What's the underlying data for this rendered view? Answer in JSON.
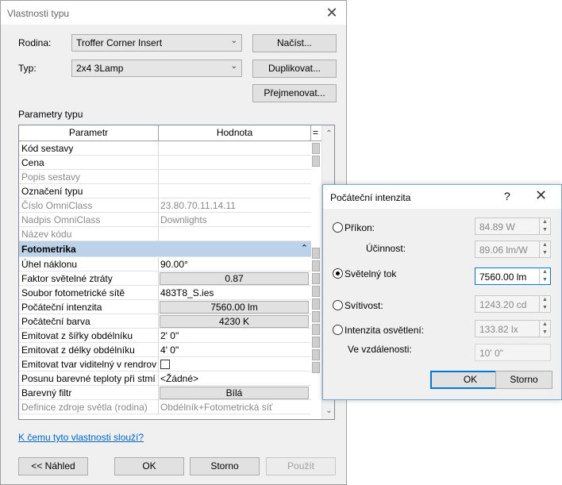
{
  "main": {
    "title": "Vlastnosti typu",
    "family_label": "Rodina:",
    "family_value": "Troffer Corner Insert",
    "type_label": "Typ:",
    "type_value": "2x4 3Lamp",
    "load_button": "Načíst...",
    "duplicate_button": "Duplikovat...",
    "rename_button": "Přejmenovat...",
    "params_label": "Parametry typu",
    "columns": [
      "Parametr",
      "Hodnota",
      "="
    ],
    "rows": [
      {
        "name": "Kód sestavy",
        "value": ""
      },
      {
        "name": "Cena",
        "value": ""
      },
      {
        "name": "Popis sestavy",
        "value": ""
      },
      {
        "name": "Označení typu",
        "value": ""
      },
      {
        "name": "Číslo OmniClass",
        "value": "23.80.70.11.14.11"
      },
      {
        "name": "Nadpis OmniClass",
        "value": "Downlights"
      },
      {
        "name": "Název kódu",
        "value": ""
      }
    ],
    "section": "Fotometrika",
    "photo_rows": [
      {
        "name": "Úhel náklonu",
        "value": "90.00°"
      },
      {
        "name": "Faktor světelné ztráty",
        "value": "0.87"
      },
      {
        "name": "Soubor fotometrické sítě",
        "value": "483T8_S.ies"
      },
      {
        "name": "Počáteční intenzita",
        "value": "7560.00 lm"
      },
      {
        "name": "Počáteční barva",
        "value": "4230 K"
      },
      {
        "name": "Emitovat z šířky obdélníku",
        "value": "2'  0\""
      },
      {
        "name": "Emitovat z délky obdélníku",
        "value": "4'  0\""
      },
      {
        "name": "Emitovat tvar viditelný v rendrov",
        "value": ""
      },
      {
        "name": "Posunu barevné teploty při stmí",
        "value": "<Žádné>"
      },
      {
        "name": "Barevný filtr",
        "value": "Bílá"
      },
      {
        "name": "Definice zdroje světla (rodina)",
        "value": "Obdélník+Fotometrická síť"
      }
    ],
    "help_link": "K čemu tyto vlastnosti slouží?",
    "preview_button": "<< Náhled",
    "ok_button": "OK",
    "cancel_button": "Storno",
    "apply_button": "Použít"
  },
  "sub": {
    "title": "Počáteční intenzita",
    "help": "?",
    "options": {
      "wattage_label": "Příkon:",
      "wattage_value": "84.89 W",
      "efficacy_label": "Účinnost:",
      "efficacy_value": "89.06 lm/W",
      "flux_label": "Světelný tok",
      "flux_value": "7560.00 lm",
      "intensity_label": "Svítivost:",
      "intensity_value": "1243.20 cd",
      "illuminance_label": "Intenzita osvětlení:",
      "illuminance_value": "133.82 lx",
      "distance_label": "Ve vzdálenosti:",
      "distance_value": "10'  0\""
    },
    "selected": "flux",
    "ok_button": "OK",
    "cancel_button": "Storno"
  }
}
